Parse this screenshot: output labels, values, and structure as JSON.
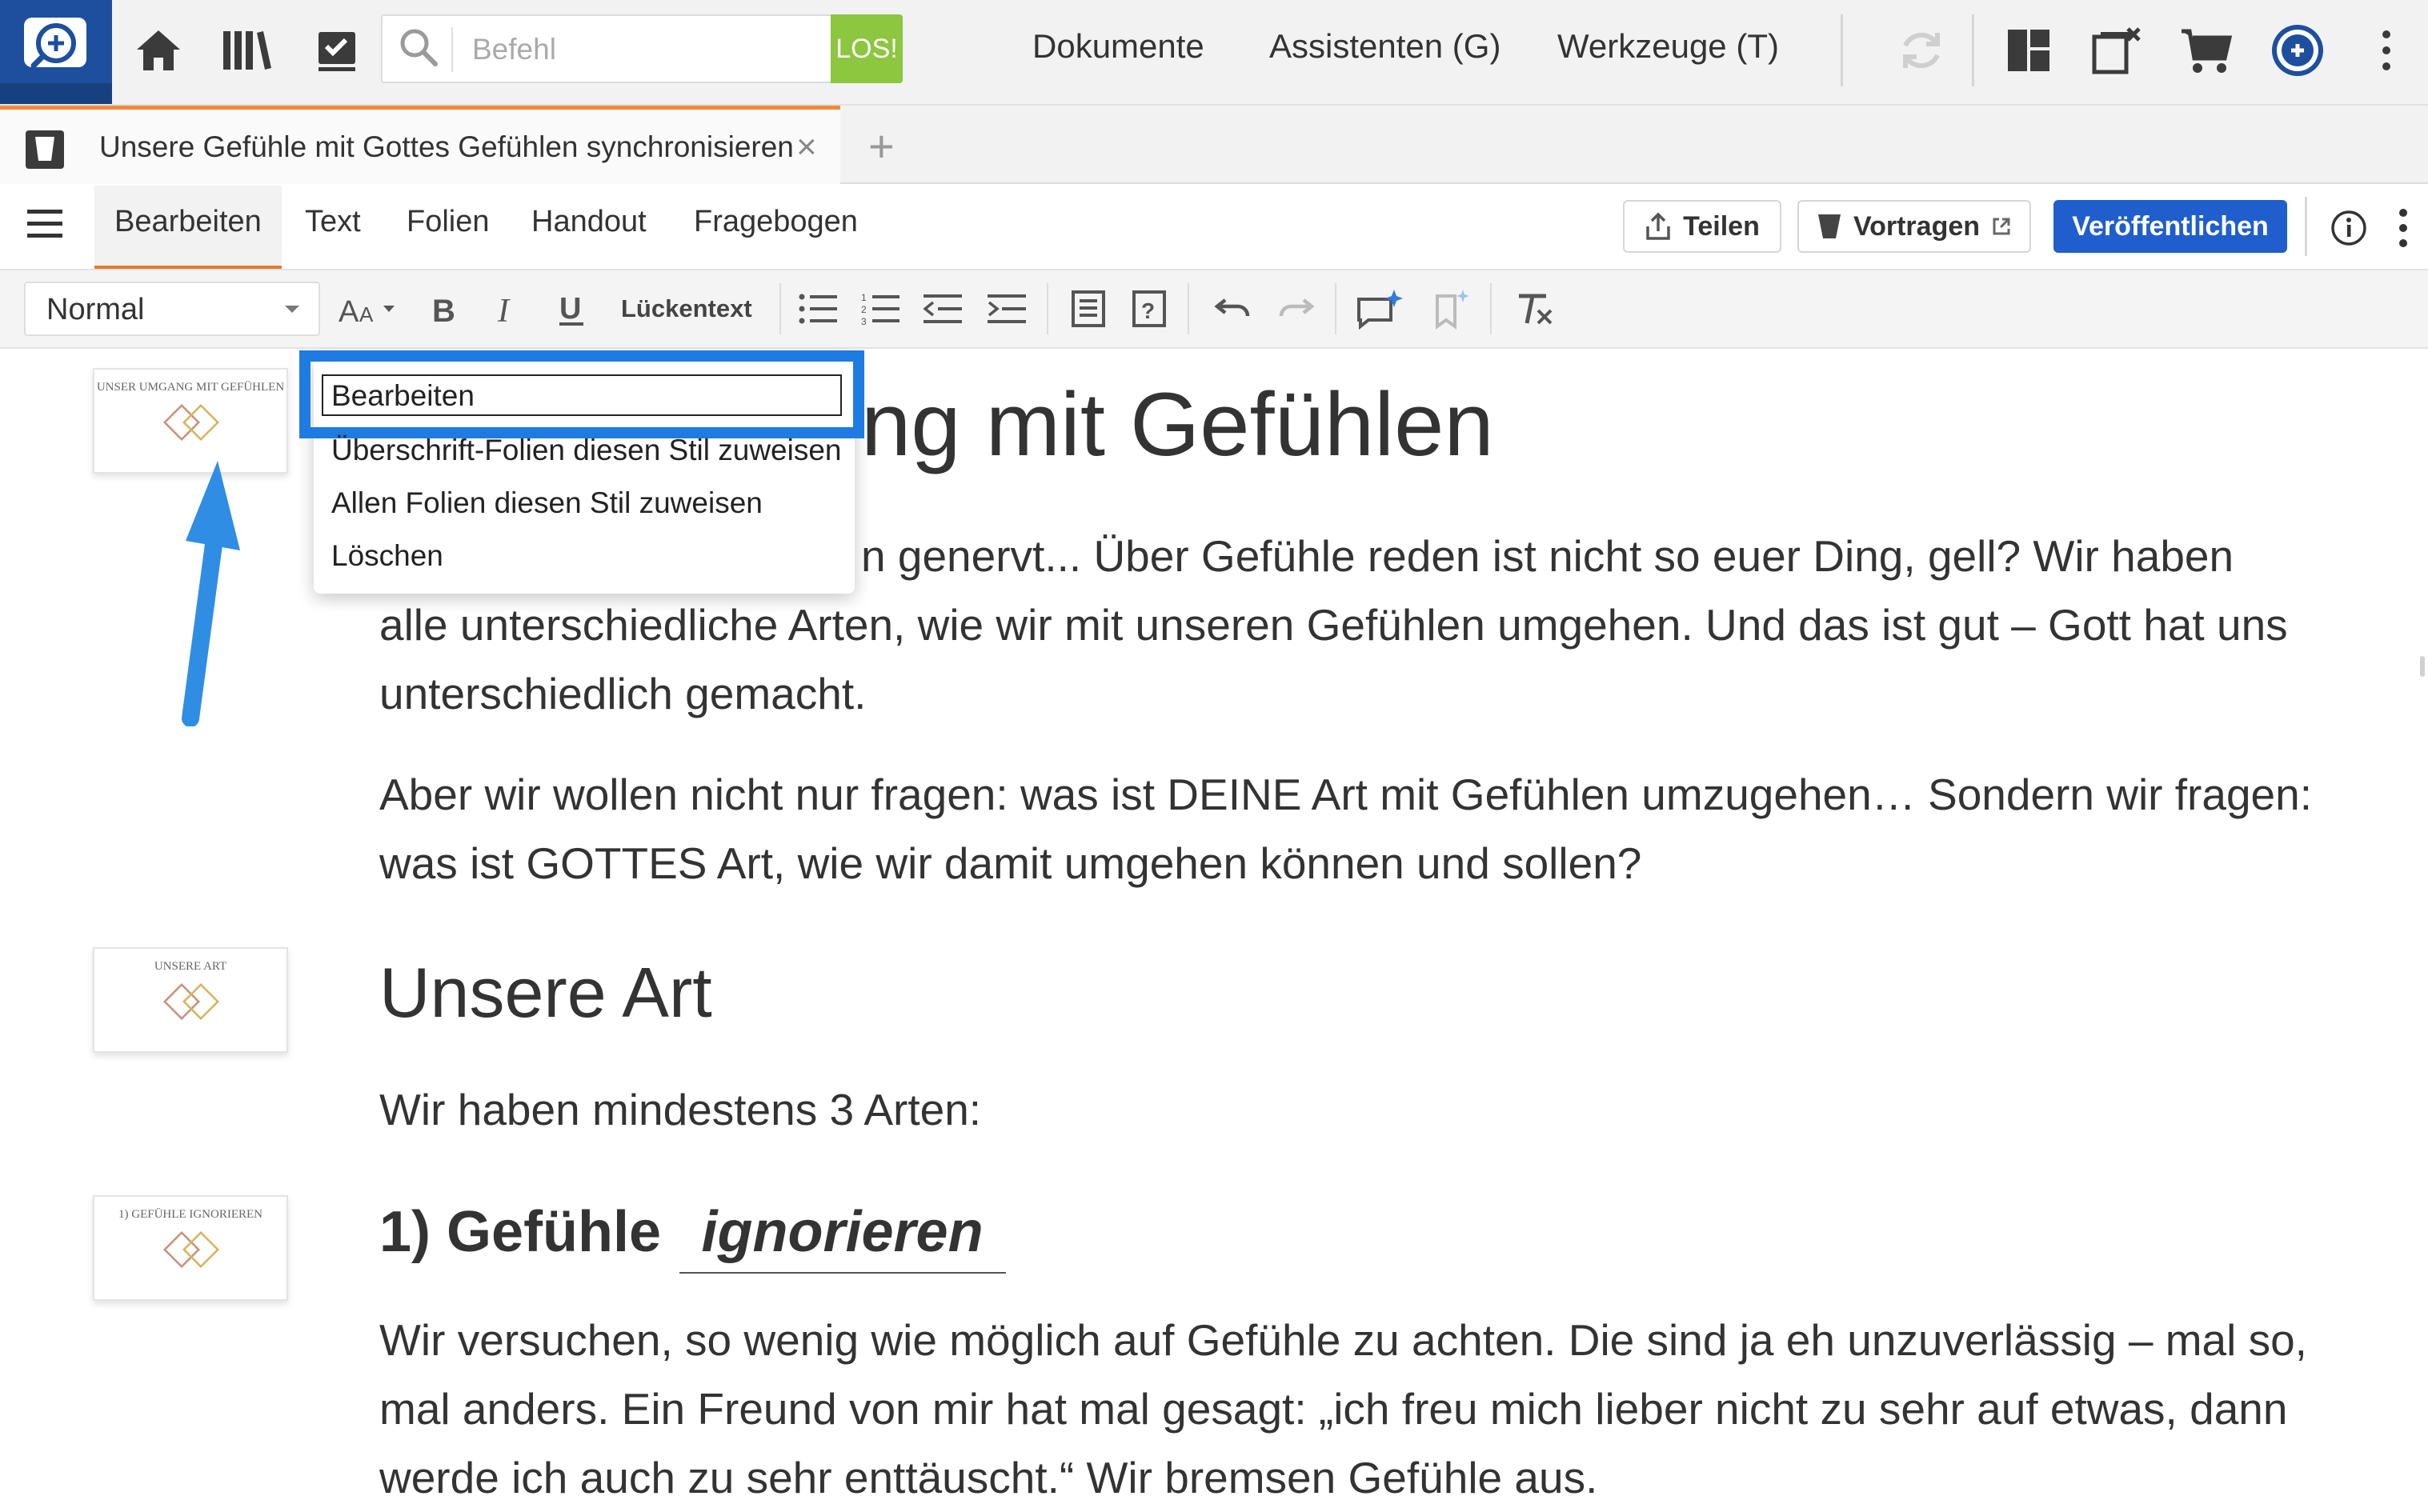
{
  "top_bar": {
    "command": {
      "placeholder": "Befehl",
      "go_label": "LOS!"
    },
    "menu": {
      "documents": "Dokumente",
      "assistants": "Assistenten (G)",
      "tools": "Werkzeuge (T)"
    }
  },
  "tab": {
    "title": "Unsere Gefühle mit Gottes Gefühlen synchronisieren",
    "close_symbol": "×",
    "new_symbol": "+"
  },
  "menu_tabs": [
    {
      "label": "Bearbeiten",
      "active": true
    },
    {
      "label": "Text",
      "active": false
    },
    {
      "label": "Folien",
      "active": false
    },
    {
      "label": "Handout",
      "active": false
    },
    {
      "label": "Fragebogen",
      "active": false
    }
  ],
  "actions": {
    "share": "Teilen",
    "present": "Vortragen",
    "publish": "Veröffentlichen"
  },
  "format_toolbar": {
    "style_value": "Normal",
    "cloze": "Lückentext"
  },
  "context_menu": {
    "items": [
      "Bearbeiten",
      "Überschrift-Folien diesen Stil zuweisen",
      "Allen Folien diesen Stil zuweisen",
      "Löschen"
    ],
    "highlighted": "Bearbeiten"
  },
  "slides": [
    {
      "thumb_text": "UNSER UMGANG MIT GEFÜHLEN"
    },
    {
      "thumb_text": "UNSERE ART"
    },
    {
      "thumb_text": "1) GEFÜHLE IGNORIEREN"
    }
  ],
  "content": {
    "heading1_visible": "ng mit Gefühlen",
    "p1_line1": "n genervt... Über Gefühle reden ist nicht so euer Ding, gell? Wir haben",
    "p1_rest": "alle unterschiedliche Arten, wie wir mit unseren Gefühlen umgehen. Und das ist gut – Gott hat uns unterschiedlich gemacht.",
    "p2": "Aber wir wollen nicht nur fragen: was ist DEINE Art mit Gefühlen umzugehen… Sondern wir fragen: was ist GOTTES Art, wie wir damit umgehen können und sollen?",
    "heading2": "Unsere Art",
    "p3": "Wir haben mindestens 3 Arten:",
    "heading3_prefix": "1) Gefühle",
    "heading3_blank": "ignorieren",
    "p4": "Wir versuchen, so wenig wie möglich auf Gefühle zu achten. Die sind ja eh unzuverlässig – mal so, mal anders. Ein Freund von mir hat mal gesagt: „ich freu mich lieber nicht zu sehr auf etwas, dann werde ich auch zu sehr enttäuscht.“ Wir bremsen Gefühle aus."
  },
  "colors": {
    "brand_blue": "#1d4f9e",
    "go_green": "#8dc63f",
    "tab_accent_orange": "#f08a3c",
    "publish_blue": "#1f5ecc",
    "highlight_blue": "#1e7be2"
  }
}
